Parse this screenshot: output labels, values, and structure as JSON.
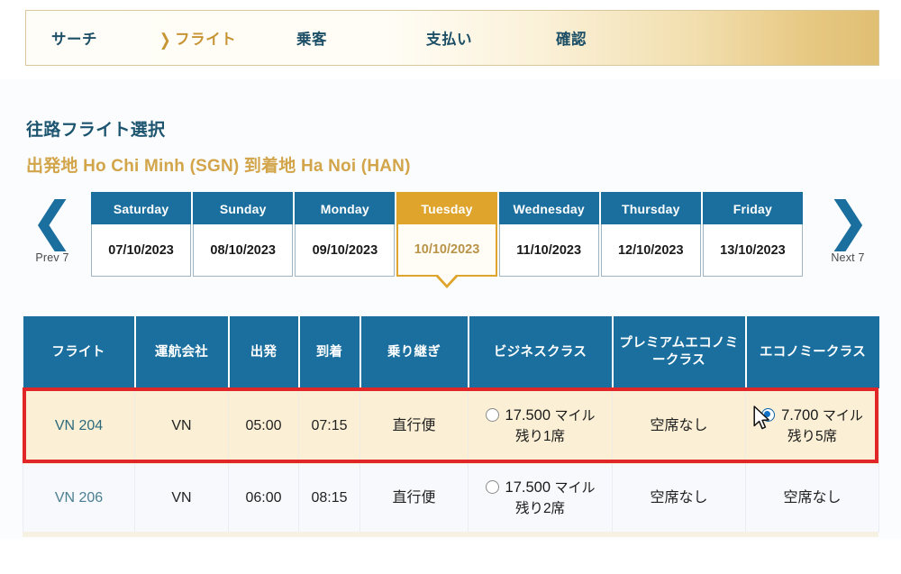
{
  "steps": [
    {
      "label": "サーチ",
      "state": "inactive"
    },
    {
      "label": "フライト",
      "state": "current",
      "chevron": "❯"
    },
    {
      "label": "乗客",
      "state": "inactive"
    },
    {
      "label": "支払い",
      "state": "inactive"
    },
    {
      "label": "確認",
      "state": "inactive"
    }
  ],
  "headings": {
    "title": "往路フライト選択",
    "route": "出発地 Ho Chi Minh (SGN) 到着地 Ha Noi (HAN)"
  },
  "date_nav": {
    "prev": {
      "glyph": "❮",
      "caption": "Prev 7"
    },
    "next": {
      "glyph": "❯",
      "caption": "Next 7"
    },
    "days": [
      {
        "name": "Saturday",
        "date": "07/10/2023",
        "selected": false
      },
      {
        "name": "Sunday",
        "date": "08/10/2023",
        "selected": false
      },
      {
        "name": "Monday",
        "date": "09/10/2023",
        "selected": false
      },
      {
        "name": "Tuesday",
        "date": "10/10/2023",
        "selected": true
      },
      {
        "name": "Wednesday",
        "date": "11/10/2023",
        "selected": false
      },
      {
        "name": "Thursday",
        "date": "12/10/2023",
        "selected": false
      },
      {
        "name": "Friday",
        "date": "13/10/2023",
        "selected": false
      }
    ]
  },
  "table": {
    "headers": [
      "フライト",
      "運航会社",
      "出発",
      "到着",
      "乗り継ぎ",
      "ビジネスクラス",
      "プレミアムエコノミークラス",
      "エコノミークラス"
    ],
    "rows": [
      {
        "flight": "VN 204",
        "carrier": "VN",
        "depart": "05:00",
        "arrive": "07:15",
        "stops": "直行便",
        "selected_row": true,
        "business": {
          "available": true,
          "miles": "17.500",
          "unit": "マイル",
          "seats": "残り1席",
          "radio": "unchecked"
        },
        "premium_economy": {
          "available": false,
          "text": "空席なし"
        },
        "economy": {
          "available": true,
          "miles": "7.700",
          "unit": "マイル",
          "seats": "残り5席",
          "radio": "checked"
        }
      },
      {
        "flight": "VN 206",
        "carrier": "VN",
        "depart": "06:00",
        "arrive": "08:15",
        "stops": "直行便",
        "selected_row": false,
        "business": {
          "available": true,
          "miles": "17.500",
          "unit": "マイル",
          "seats": "残り2席",
          "radio": "unchecked"
        },
        "premium_economy": {
          "available": false,
          "text": "空席なし"
        },
        "economy": {
          "available": false,
          "text": "空席なし"
        }
      }
    ]
  },
  "colors": {
    "header_blue": "#1a6f9e",
    "accent_gold": "#dfa42c",
    "highlight_red": "#e02626",
    "selected_row_bg": "#fbf0d5",
    "radio_blue": "#1072c6"
  }
}
